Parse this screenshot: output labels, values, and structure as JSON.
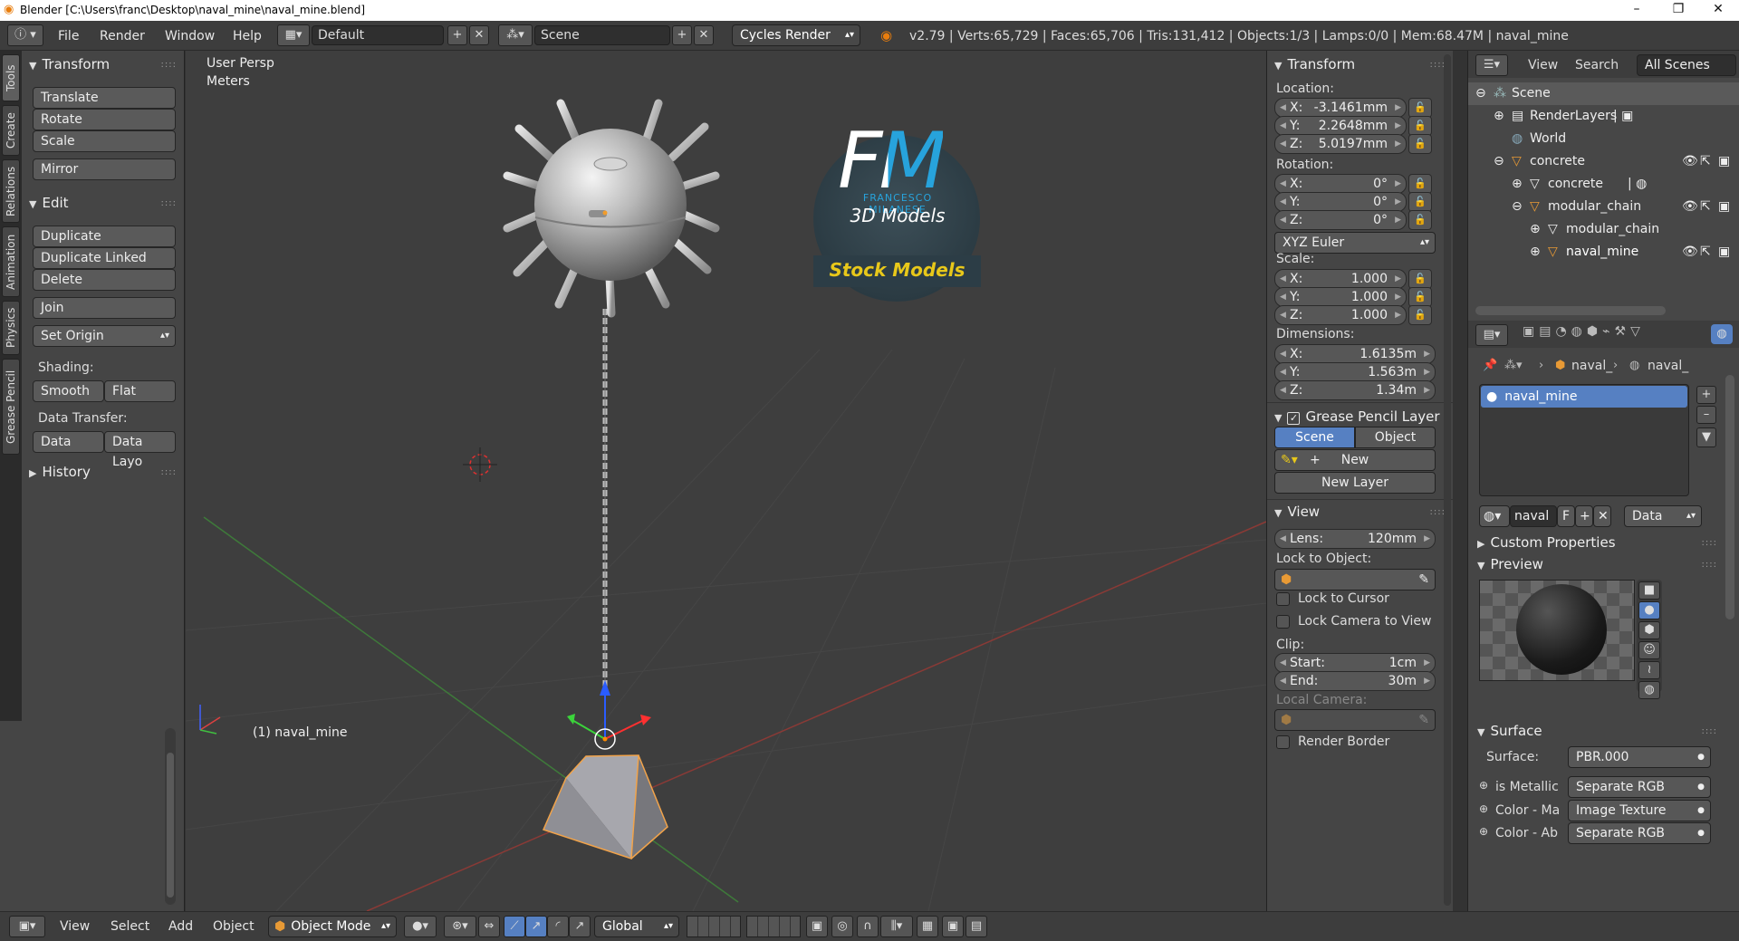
{
  "window": {
    "title": "Blender [C:\\Users\\franc\\Desktop\\naval_mine\\naval_mine.blend]",
    "controls": [
      "–",
      "❐",
      "✕"
    ]
  },
  "topbar": {
    "menus": [
      "File",
      "Render",
      "Window",
      "Help"
    ],
    "layout": "Default",
    "scene": "Scene",
    "engine": "Cycles Render",
    "stats": "v2.79 | Verts:65,729 | Faces:65,706 | Tris:131,412 | Objects:1/3 | Lamps:0/0 | Mem:68.47M | naval_mine"
  },
  "left_tabs": [
    "Tools",
    "Create",
    "Relations",
    "Animation",
    "Physics",
    "Grease Pencil"
  ],
  "toolshelf": {
    "transform": {
      "title": "Transform",
      "buttons": [
        "Translate",
        "Rotate",
        "Scale",
        "Mirror"
      ]
    },
    "edit": {
      "title": "Edit",
      "buttons": [
        "Duplicate",
        "Duplicate Linked",
        "Delete",
        "Join",
        "Set Origin"
      ],
      "shading_label": "Shading:",
      "shading": [
        "Smooth",
        "Flat"
      ],
      "data_transfer_label": "Data Transfer:",
      "data_transfer": [
        "Data",
        "Data Layo"
      ]
    },
    "history": "History"
  },
  "viewport": {
    "view_name": "User Persp",
    "units": "Meters",
    "object_label": "(1) naval_mine",
    "logo": {
      "initials": "FM",
      "name": "FRANCESCO MILANESE",
      "tagline": "3D Models",
      "banner": "Stock Models"
    }
  },
  "npanel": {
    "transform_title": "Transform",
    "location_label": "Location:",
    "location": [
      {
        "k": "X:",
        "v": "-3.1461mm"
      },
      {
        "k": "Y:",
        "v": "2.2648mm"
      },
      {
        "k": "Z:",
        "v": "5.0197mm"
      }
    ],
    "rotation_label": "Rotation:",
    "rotation": [
      {
        "k": "X:",
        "v": "0°"
      },
      {
        "k": "Y:",
        "v": "0°"
      },
      {
        "k": "Z:",
        "v": "0°"
      }
    ],
    "rotation_mode": "XYZ Euler",
    "scale_label": "Scale:",
    "scale": [
      {
        "k": "X:",
        "v": "1.000"
      },
      {
        "k": "Y:",
        "v": "1.000"
      },
      {
        "k": "Z:",
        "v": "1.000"
      }
    ],
    "dimensions_label": "Dimensions:",
    "dimensions": [
      {
        "k": "X:",
        "v": "1.6135m"
      },
      {
        "k": "Y:",
        "v": "1.563m"
      },
      {
        "k": "Z:",
        "v": "1.34m"
      }
    ],
    "gp_title": "Grease Pencil Layer",
    "gp_tabs": [
      "Scene",
      "Object"
    ],
    "gp_new": "New",
    "gp_new_layer": "New Layer",
    "view_title": "View",
    "lens_label": "Lens:",
    "lens": "120mm",
    "lock_object_label": "Lock to Object:",
    "lock_cursor": "Lock to Cursor",
    "lock_camera": "Lock Camera to View",
    "clip_label": "Clip:",
    "clip_start_label": "Start:",
    "clip_start": "1cm",
    "clip_end_label": "End:",
    "clip_end": "30m",
    "local_camera": "Local Camera:",
    "render_border": "Render Border"
  },
  "outliner": {
    "header": [
      "View",
      "Search",
      "All Scenes"
    ],
    "rows": [
      {
        "label": "Scene"
      },
      {
        "label": "RenderLayers"
      },
      {
        "label": "World"
      },
      {
        "label": "concrete"
      },
      {
        "label": "concrete"
      },
      {
        "label": "modular_chain"
      },
      {
        "label": "modular_chain"
      },
      {
        "label": "naval_mine"
      }
    ]
  },
  "properties": {
    "breadcrumb": [
      "naval_",
      "naval_"
    ],
    "material_slot": "naval_mine",
    "material_name": "naval",
    "material_f": "F",
    "link": "Data",
    "custom_properties": "Custom Properties",
    "preview": "Preview",
    "surface_title": "Surface",
    "surface_label": "Surface:",
    "surface_value": "PBR.000",
    "inputs": [
      {
        "label": "is Metallic",
        "value": "Separate RGB"
      },
      {
        "label": "Color - Ma",
        "value": "Image Texture"
      },
      {
        "label": "Color - Ab",
        "value": "Separate RGB"
      }
    ]
  },
  "bottombar": {
    "menus": [
      "View",
      "Select",
      "Add",
      "Object"
    ],
    "mode": "Object Mode",
    "orientation": "Global"
  }
}
